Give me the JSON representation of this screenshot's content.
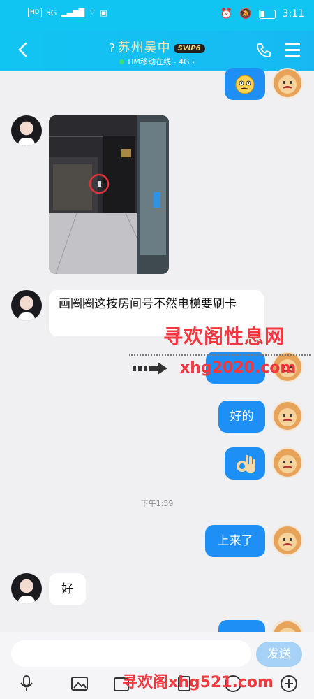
{
  "status": {
    "network_tag": "HD",
    "signal": "5G",
    "time": "3:11"
  },
  "header": {
    "title": "苏州吴中",
    "vip_badge": "SVIP6",
    "subtitle": "TIM移动在线 - 4G"
  },
  "messages": {
    "m2_text": "画圈圈这按房间号不然电梯要刷卡",
    "m4_text": "好的",
    "timestamp": "下午1:59",
    "m6_text": "上来了",
    "m7_text": "好"
  },
  "watermarks": {
    "site_cn": "寻欢阁性息网",
    "site_url": "xhg2020.com",
    "bottom": "寻欢阁xhg521.com"
  },
  "input": {
    "placeholder": "",
    "send_label": "发送"
  },
  "colors": {
    "header": "#11c5f2",
    "bubble_out": "#1d8ff5",
    "watermark": "#f2373f"
  }
}
